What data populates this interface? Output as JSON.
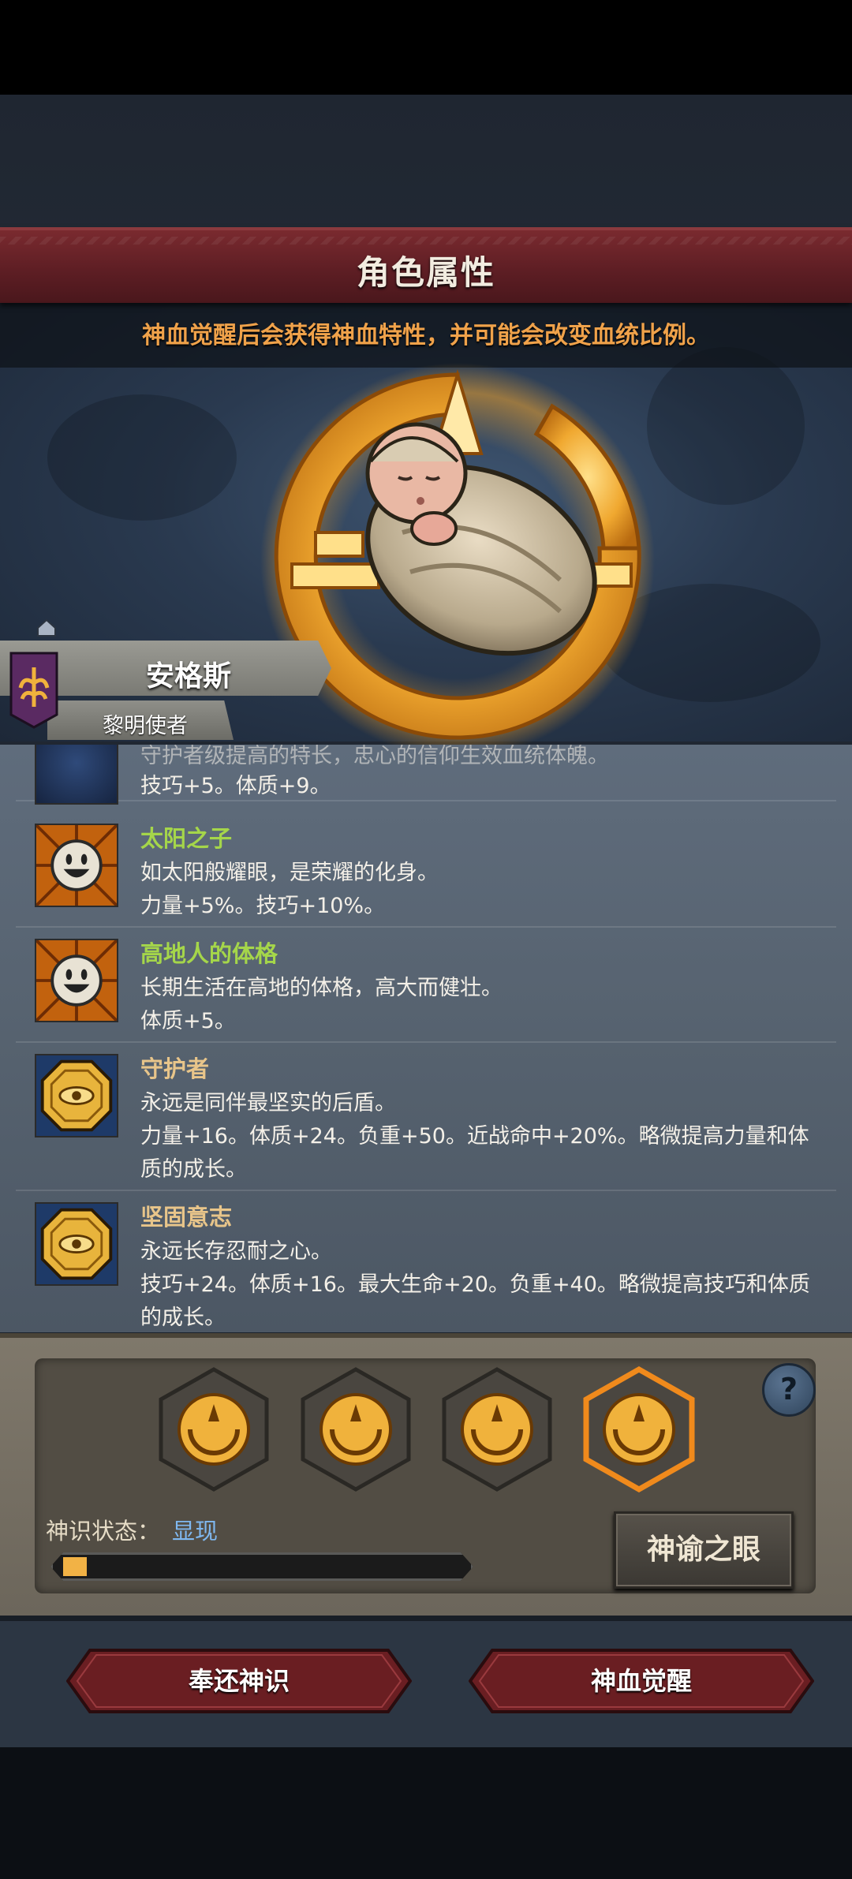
{
  "header": {
    "title": "角色属性"
  },
  "hero": {
    "description": "神血觉醒后会获得神血特性，并可能会改变血统比例。"
  },
  "character": {
    "name": "安格斯",
    "title": "黎明使者"
  },
  "traits": [
    {
      "name": "",
      "lines": [
        "守护者级提高的特长，忠心的信仰生效血统体魄。",
        "技巧+5。体质+9。"
      ],
      "icon": "wolf-icon"
    },
    {
      "name": "太阳之子",
      "lines": [
        "如太阳般耀眼，是荣耀的化身。",
        "力量+5%。技巧+10%。"
      ],
      "icon": "smiley-sun-icon"
    },
    {
      "name": "高地人的体格",
      "lines": [
        "长期生活在高地的体格，高大而健壮。",
        "体质+5。"
      ],
      "icon": "smiley-sun-icon"
    },
    {
      "name": "守护者",
      "lines": [
        "永远是同伴最坚实的后盾。",
        "力量+16。体质+24。负重+50。近战命中+20%。略微提高力量和体",
        "质的成长。"
      ],
      "icon": "gold-octagon-eye-icon"
    },
    {
      "name": "坚固意志",
      "lines": [
        "永远长存忍耐之心。",
        "技巧+24。体质+16。最大生命+20。负重+40。略微提高技巧和体质",
        "的成长。"
      ],
      "icon": "gold-octagon-eye-icon"
    }
  ],
  "divine_sense": {
    "state_label": "神识状态：",
    "state_value": "显现",
    "progress": 0.06,
    "slots": 4,
    "active_slot": 4,
    "oracle_button": "神谕之眼",
    "help": "?"
  },
  "footer": {
    "return_button": "奉还神识",
    "awaken_button": "神血觉醒"
  },
  "colors": {
    "accent_gold": "#f2b245",
    "title_red": "#5e1e24",
    "trait_green": "#a5d64a",
    "trait_gold": "#e8c58a",
    "state_blue": "#7fb8f0"
  }
}
